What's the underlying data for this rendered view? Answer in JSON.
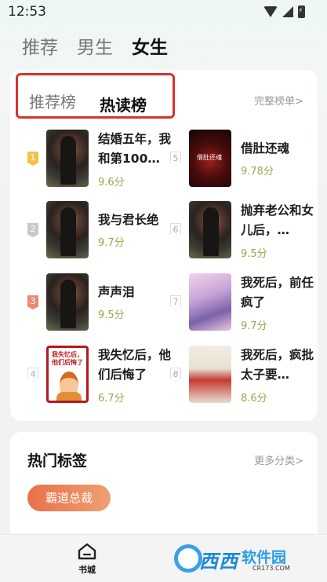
{
  "status": {
    "time": "12:53"
  },
  "top_tabs": [
    "推荐",
    "男生",
    "女生"
  ],
  "rank": {
    "tabs": [
      "推荐榜",
      "热读榜"
    ],
    "full_list": "完整榜单>",
    "left": [
      {
        "rank": "1",
        "title": "结婚五年，我和第100…",
        "score": "9.6分",
        "cover": "dark",
        "cover_text": ""
      },
      {
        "rank": "2",
        "title": "我与君长绝",
        "score": "9.7分",
        "cover": "dark",
        "cover_text": ""
      },
      {
        "rank": "3",
        "title": "声声泪",
        "score": "9.5分",
        "cover": "dark",
        "cover_text": ""
      },
      {
        "rank": "4",
        "title": "我失忆后，他们后悔了",
        "score": "6.7分",
        "cover": "cartoon",
        "cover_text": "我失忆后，他们后悔了"
      }
    ],
    "right": [
      {
        "rank": "5",
        "title": "借肚还魂",
        "score": "9.78分",
        "cover": "red",
        "cover_text": "借肚还魂"
      },
      {
        "rank": "6",
        "title": "抛弃老公和女儿后，…",
        "score": "9.5分",
        "cover": "dark",
        "cover_text": ""
      },
      {
        "rank": "7",
        "title": "我死后，前任疯了",
        "score": "9.7分",
        "cover": "purple",
        "cover_text": ""
      },
      {
        "rank": "8",
        "title": "我死后，疯批太子要…",
        "score": "8.6分",
        "cover": "ink",
        "cover_text": ""
      }
    ]
  },
  "tags": {
    "title": "热门标签",
    "more": "更多分类>",
    "chip": "霸道总裁"
  },
  "nav": {
    "home_label": "书城"
  },
  "watermark": {
    "brand": "西西",
    "text": "软件园",
    "sub": "CR173.COM"
  }
}
